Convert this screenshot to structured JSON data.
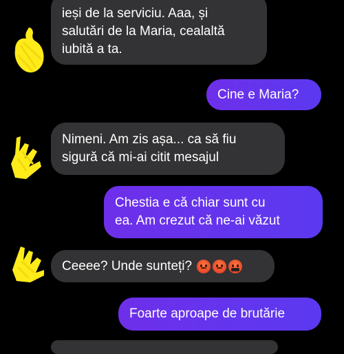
{
  "messages": [
    {
      "id": "m1",
      "direction": "incoming",
      "lines": [
        "ieși de la serviciu. Aaa, și",
        "salutări de la Maria, cealaltă",
        "iubită a ta."
      ]
    },
    {
      "id": "m2",
      "direction": "outgoing",
      "lines": [
        "Cine e Maria?"
      ]
    },
    {
      "id": "m3",
      "direction": "incoming",
      "lines": [
        "Nimeni. Am zis așa... ca să fiu",
        "sigură că mi-ai citit mesajul"
      ]
    },
    {
      "id": "m4",
      "direction": "outgoing",
      "lines": [
        "Chestia e că chiar sunt cu",
        "ea. Am crezut că ne-ai văzut"
      ]
    },
    {
      "id": "m5",
      "direction": "incoming",
      "text": "Ceeee? Unde sunteți?",
      "emojis": [
        "angry-face-icon",
        "angry-face-icon",
        "cursing-face-icon"
      ]
    },
    {
      "id": "m6",
      "direction": "outgoing",
      "lines": [
        "Foarte aproape de brutărie"
      ]
    }
  ],
  "colors": {
    "background": "#000000",
    "incoming_bubble": "#333335",
    "outgoing_bubble": "#6a31ec",
    "avatar_scribble": "#ffeb1a",
    "text": "#ffffff"
  }
}
